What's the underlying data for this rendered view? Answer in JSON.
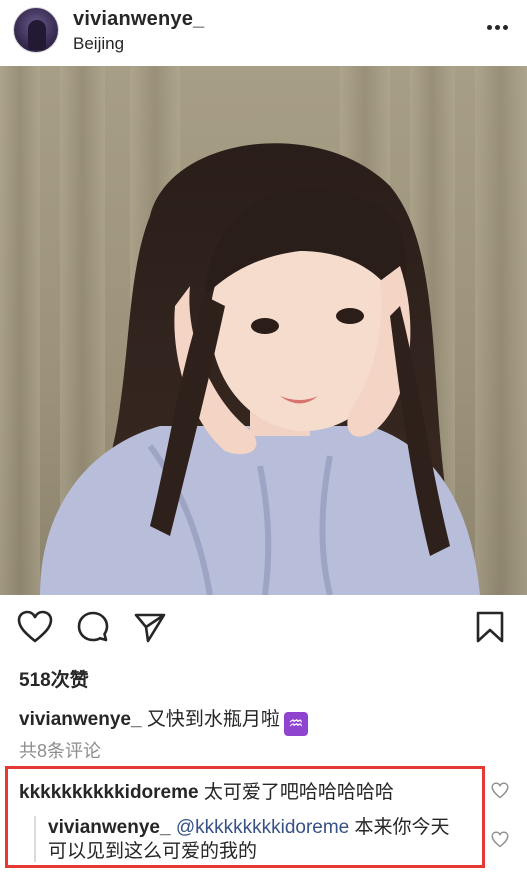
{
  "post": {
    "username": "vivianwenye_",
    "location": "Beijing",
    "more_icon": "more-horizontal-icon"
  },
  "actions": {
    "like_icon": "heart-outline-icon",
    "comment_icon": "comment-bubble-icon",
    "share_icon": "paper-plane-icon",
    "save_icon": "bookmark-icon"
  },
  "likes": "518次赞",
  "caption": {
    "username": "vivianwenye_",
    "text": "又快到水瓶月啦",
    "emoji": "♒"
  },
  "view_all_comments": "共8条评论",
  "comments": [
    {
      "username": "kkkkkkkkkkidoreme",
      "text": "太可爱了吧哈哈哈哈哈",
      "like_icon": "heart-small-icon"
    }
  ],
  "reply": {
    "username": "vivianwenye_",
    "mention": "@kkkkkkkkkidoreme",
    "text": "本来你今天可以见到这么可爱的我的",
    "like_icon": "heart-small-icon"
  },
  "colors": {
    "highlight_border": "#e53935",
    "mention": "#385185",
    "muted": "#8e8e8e"
  }
}
